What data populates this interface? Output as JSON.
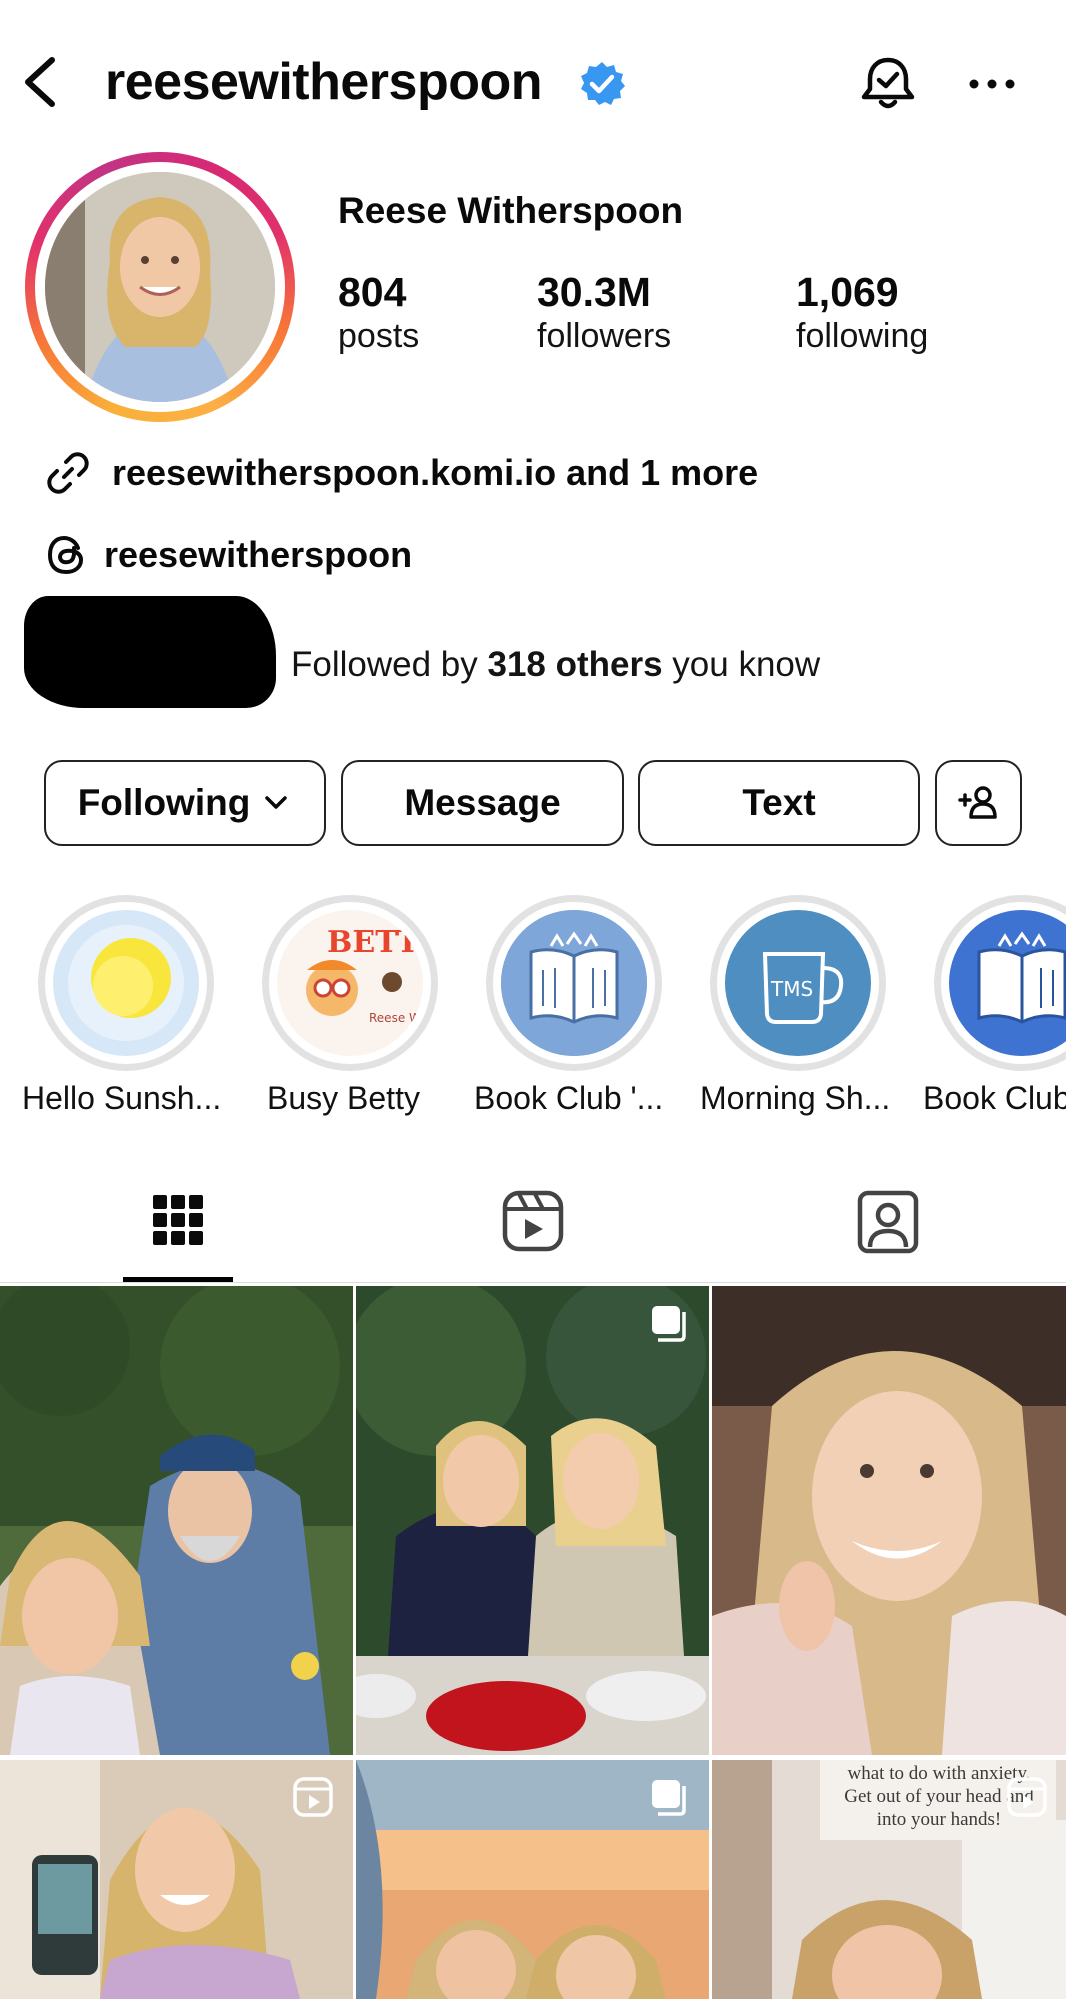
{
  "header": {
    "username": "reesewitherspoon",
    "icons": {
      "back": "chevron-left-icon",
      "verified": "verified-badge-icon",
      "notifications": "bell-check-icon",
      "more": "more-horizontal-icon"
    }
  },
  "profile": {
    "full_name": "Reese Witherspoon",
    "stats": [
      {
        "value": "804",
        "label": "posts"
      },
      {
        "value": "30.3M",
        "label": "followers"
      },
      {
        "value": "1,069",
        "label": "following"
      }
    ],
    "link": "reesewitherspoon.komi.io and 1 more",
    "threads_handle": "reesewitherspoon",
    "mutual": {
      "prefix": "Followed by ",
      "count": "318 others",
      "suffix": " you know"
    }
  },
  "actions": {
    "following": "Following",
    "message": "Message",
    "text": "Text"
  },
  "highlights": [
    {
      "label": "Hello Sunsh..."
    },
    {
      "label": "Busy Betty",
      "art_text": "BETTY",
      "art_subtext": "Reese Wither"
    },
    {
      "label": "Book Club '..."
    },
    {
      "label": "Morning Sh...",
      "art_text": "TMS"
    },
    {
      "label": "Book Club"
    }
  ],
  "tabs": [
    {
      "name": "posts",
      "icon": "grid-icon",
      "active": true
    },
    {
      "name": "reels",
      "icon": "reels-icon",
      "active": false
    },
    {
      "name": "tagged",
      "icon": "tagged-person-icon",
      "active": false
    }
  ],
  "grid": {
    "posts": [
      {
        "type": "photo",
        "badge": ""
      },
      {
        "type": "carousel",
        "badge": "carousel-icon"
      },
      {
        "type": "photo",
        "badge": ""
      },
      {
        "type": "reel",
        "badge": "reels-icon"
      },
      {
        "type": "carousel",
        "badge": "carousel-icon"
      },
      {
        "type": "reel",
        "badge": "reels-icon",
        "caption_lines": [
          "what to do with anxiety.",
          "Get out of your head and",
          "into your hands!"
        ]
      }
    ]
  },
  "colors": {
    "verified": "#3897f0",
    "story_ring_start": "#fcaf45",
    "story_ring_end": "#c13584",
    "highlight_blue": "#7ea6d8",
    "highlight_royal": "#3e73d1",
    "highlight_teal": "#4f8ec0",
    "text": "#0a0a0a"
  }
}
